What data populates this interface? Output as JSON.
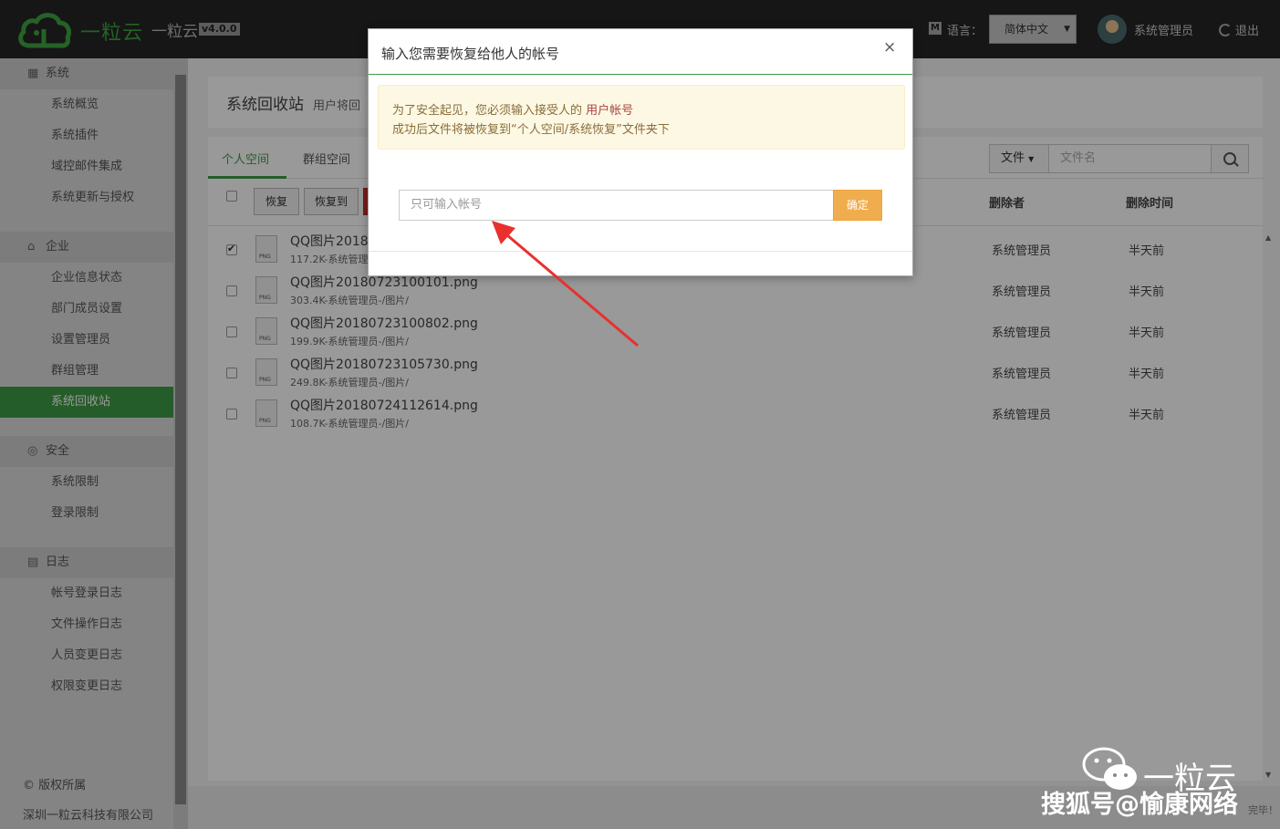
{
  "header": {
    "logo_text": "一粒云",
    "app_name": "一粒云",
    "version": "v4.0.0",
    "lang_label": "语言：",
    "lang_value": "简体中文",
    "user_name": "系统管理员",
    "logout": "退出",
    "colors": {
      "bar": "#262626",
      "brand_green": "#3fa341"
    }
  },
  "sidebar": {
    "sections": [
      {
        "label": "系统",
        "icon": "grid-icon",
        "items": [
          "系统概览",
          "系统插件",
          "域控邮件集成",
          "系统更新与授权"
        ]
      },
      {
        "label": "企业",
        "icon": "home-icon",
        "items": [
          "企业信息状态",
          "部门成员设置",
          "设置管理员",
          "群组管理",
          "系统回收站"
        ]
      },
      {
        "label": "安全",
        "icon": "globe-icon",
        "items": [
          "系统限制",
          "登录限制"
        ]
      },
      {
        "label": "日志",
        "icon": "calendar-icon",
        "items": [
          "帐号登录日志",
          "文件操作日志",
          "人员变更日志",
          "权限变更日志"
        ]
      }
    ],
    "active_item": "系统回收站",
    "copyright": "版权所属",
    "company": "深圳一粒云科技有限公司"
  },
  "page": {
    "title": "系统回收站",
    "subtitle": "用户将回",
    "tabs": [
      "个人空间",
      "群组空间"
    ],
    "active_tab": "个人空间",
    "filter_type": "文件",
    "filter_placeholder": "文件名",
    "buttons": [
      "恢复",
      "恢复到"
    ],
    "columns": {
      "deleter": "删除者",
      "time": "删除时间"
    },
    "files": [
      {
        "name": "QQ图片2018",
        "meta": "117.2K-系统管理",
        "deleter": "系统管理员",
        "time": "半天前",
        "checked": true
      },
      {
        "name": "QQ图片20180723100101.png",
        "meta": "303.4K-系统管理员-/图片/",
        "deleter": "系统管理员",
        "time": "半天前",
        "checked": false
      },
      {
        "name": "QQ图片20180723100802.png",
        "meta": "199.9K-系统管理员-/图片/",
        "deleter": "系统管理员",
        "time": "半天前",
        "checked": false
      },
      {
        "name": "QQ图片20180723105730.png",
        "meta": "249.8K-系统管理员-/图片/",
        "deleter": "系统管理员",
        "time": "半天前",
        "checked": false
      },
      {
        "name": "QQ图片20180724112614.png",
        "meta": "108.7K-系统管理员-/图片/",
        "deleter": "系统管理员",
        "time": "半天前",
        "checked": false
      }
    ],
    "file_icon_label": "PNG",
    "status": "完毕！"
  },
  "modal": {
    "title": "输入您需要恢复给他人的帐号",
    "close": "×",
    "alert_line1_prefix": "为了安全起见，您必须输入接受人的",
    "alert_line1_highlight": "用户帐号",
    "alert_line2": "成功后文件将被恢复到“个人空间/系统恢复”文件夹下",
    "input_placeholder": "只可输入帐号",
    "confirm": "确定",
    "colors": {
      "accent": "#3e9c46",
      "confirm": "#f0ad4e",
      "arrow": "#e8302e"
    }
  },
  "watermark": {
    "brand": "一粒云",
    "text": "搜狐号@愉康网络"
  }
}
